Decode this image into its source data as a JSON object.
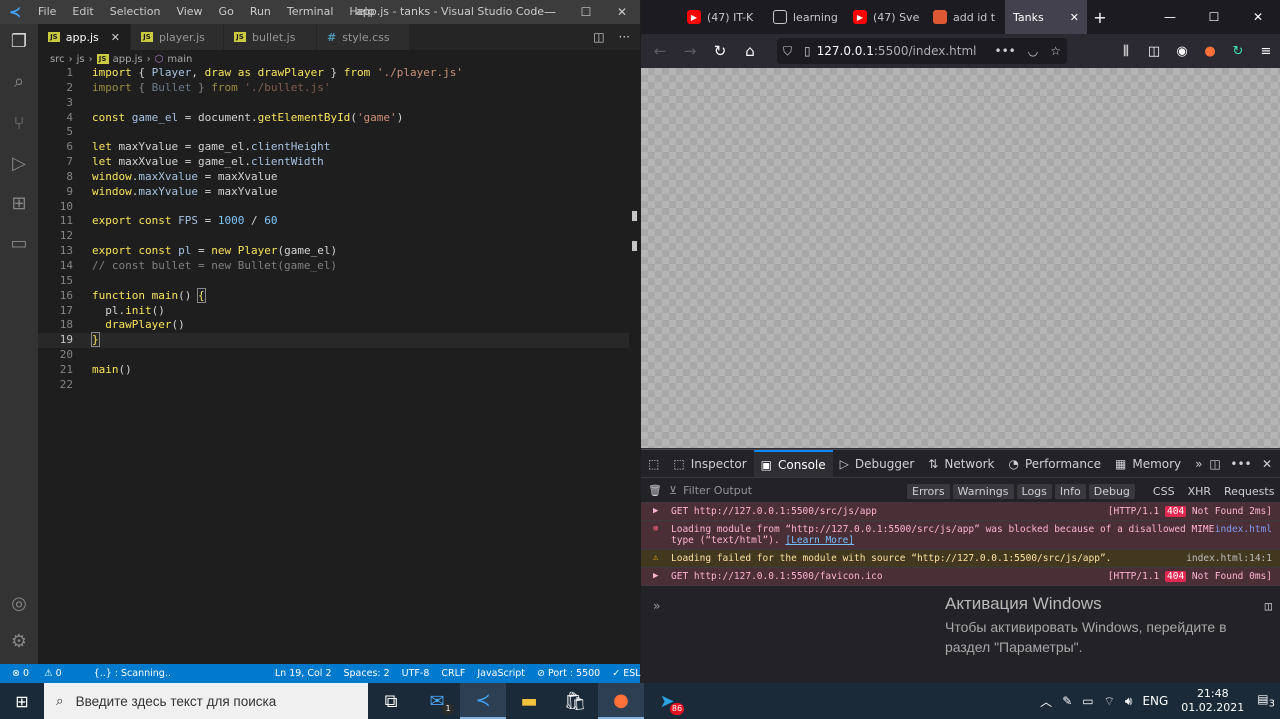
{
  "vscode": {
    "menu": [
      "File",
      "Edit",
      "Selection",
      "View",
      "Go",
      "Run",
      "Terminal",
      "Help"
    ],
    "window_title": "app.js - tanks - Visual Studio Code",
    "tabs": [
      {
        "label": "app.js",
        "active": true,
        "type": "JS"
      },
      {
        "label": "player.js",
        "active": false,
        "type": "JS"
      },
      {
        "label": "bullet.js",
        "active": false,
        "type": "JS"
      },
      {
        "label": "style.css",
        "active": false,
        "type": "CSS"
      }
    ],
    "breadcrumb": [
      "src",
      "js",
      "app.js",
      "main"
    ],
    "current_line": 19,
    "code_lines": [
      "1",
      "2",
      "3",
      "4",
      "5",
      "6",
      "7",
      "8",
      "9",
      "10",
      "11",
      "12",
      "13",
      "14",
      "15",
      "16",
      "17",
      "18",
      "19",
      "20",
      "21",
      "22"
    ],
    "status": {
      "errors": "⊗ 0",
      "warnings": "⚠ 0",
      "scanning": "{..} : Scanning..",
      "position": "Ln 19, Col 2",
      "spaces": "Spaces: 2",
      "encoding": "UTF-8",
      "eol": "CRLF",
      "language": "JavaScript",
      "port": "⊘ Port : 5500",
      "eslint": "✓ ESLint"
    }
  },
  "browser": {
    "tabs": [
      {
        "label": "(47) IT-K",
        "favicon": "youtube-icon"
      },
      {
        "label": "learning",
        "favicon": "github-icon"
      },
      {
        "label": "(47) Sve",
        "favicon": "youtube-icon"
      },
      {
        "label": "add id t",
        "favicon": "duckduckgo-icon"
      },
      {
        "label": "Tanks",
        "favicon": "none",
        "active": true
      }
    ],
    "url_host": "127.0.0.1",
    "url_path": ":5500/index.html",
    "devtools_tabs": [
      "Inspector",
      "Console",
      "Debugger",
      "Network",
      "Performance",
      "Memory"
    ],
    "devtools_active": "Console",
    "filter_placeholder": "Filter Output",
    "filter_buttons": [
      "Errors",
      "Warnings",
      "Logs",
      "Info",
      "Debug"
    ],
    "filter_plain": [
      "CSS",
      "XHR",
      "Requests"
    ],
    "console": [
      {
        "type": "err",
        "text": "GET http://127.0.0.1:5500/src/js/app",
        "http": "[HTTP/1.1",
        "status": "404",
        "result": "Not Found 2ms]"
      },
      {
        "type": "err",
        "text1": "Loading module from “http://127.0.0.1:5500/src/js/app” was blocked because of a disallowed MIME",
        "text2": "type (“text/html”).",
        "link": "[Learn More]",
        "source": "index.html"
      },
      {
        "type": "warn",
        "text": "Loading failed for the module with source “http://127.0.0.1:5500/src/js/app”.",
        "source": "index.html:14:1"
      },
      {
        "type": "err",
        "text": "GET http://127.0.0.1:5500/favicon.ico",
        "http": "[HTTP/1.1",
        "status": "404",
        "result": "Not Found 0ms]"
      }
    ]
  },
  "windows_activation": {
    "title": "Активация Windows",
    "body": "Чтобы активировать Windows, перейдите в раздел \"Параметры\"."
  },
  "taskbar": {
    "search_placeholder": "Введите здесь текст для поиска",
    "language": "ENG",
    "time": "21:48",
    "date": "01.02.2021",
    "notifications": "3",
    "mail_badge": "1",
    "telegram_badge": "86"
  }
}
